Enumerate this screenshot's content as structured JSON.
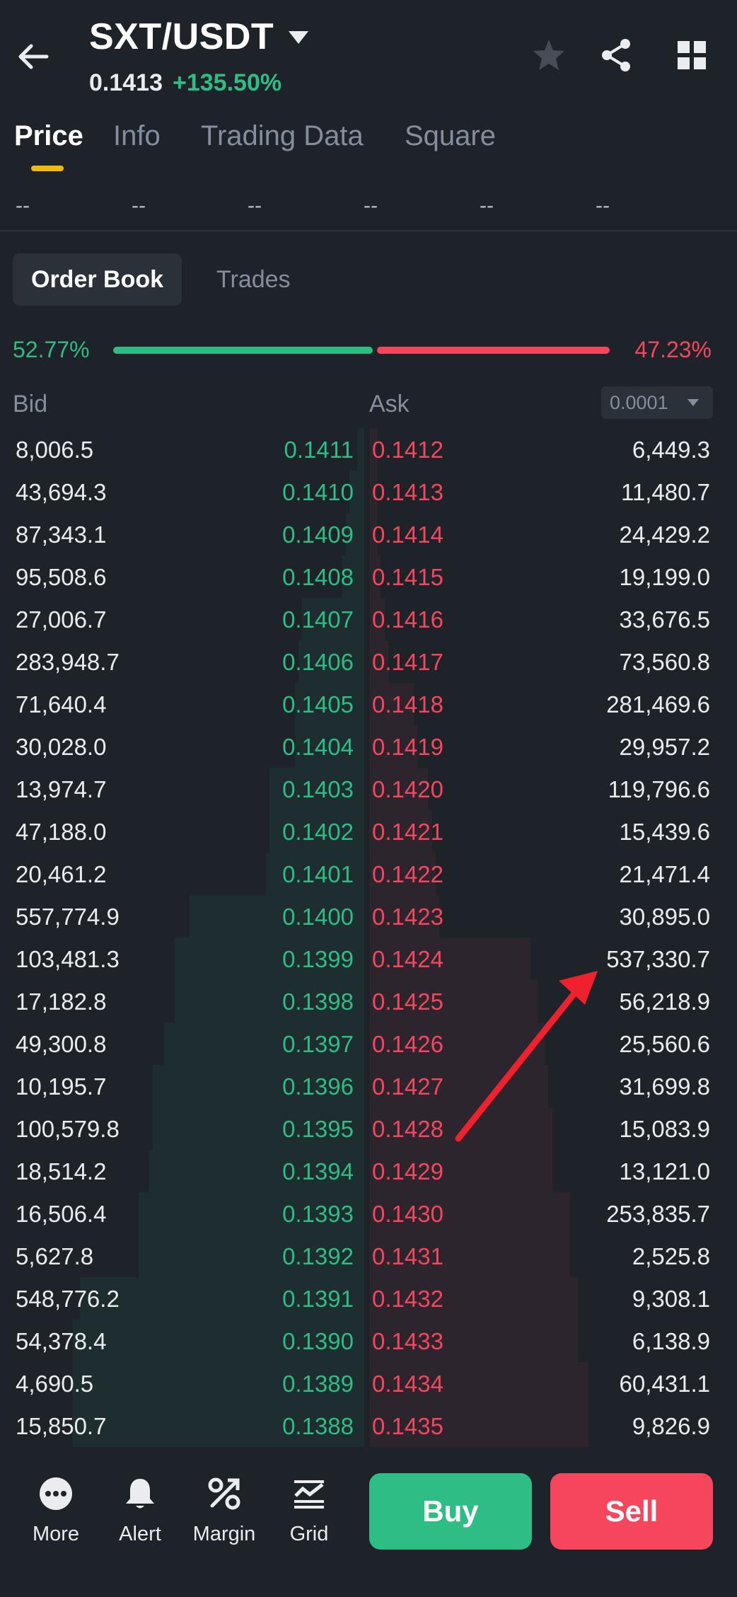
{
  "header": {
    "pair": "SXT/USDT",
    "last_price": "0.1413",
    "change": "+135.50%"
  },
  "tabs": [
    {
      "label": "Price"
    },
    {
      "label": "Info"
    },
    {
      "label": "Trading Data"
    },
    {
      "label": "Square"
    }
  ],
  "periods": [
    {
      "value": "--"
    },
    {
      "value": "--"
    },
    {
      "value": "--"
    },
    {
      "value": "--"
    },
    {
      "value": "--"
    },
    {
      "value": "--"
    }
  ],
  "order_book": {
    "tabs": [
      "Order Book",
      "Trades"
    ],
    "bid_ratio": "52.77%",
    "ask_ratio": "47.23%",
    "bid_ratio_value": 52.77,
    "bid_header": "Bid",
    "ask_header": "Ask",
    "precision": "0.0001",
    "rows": [
      {
        "bid_qty": "8,006.5",
        "bid_price": "0.1411",
        "ask_price": "0.1412",
        "ask_qty": "6,449.3"
      },
      {
        "bid_qty": "43,694.3",
        "bid_price": "0.1410",
        "ask_price": "0.1413",
        "ask_qty": "11,480.7"
      },
      {
        "bid_qty": "87,343.1",
        "bid_price": "0.1409",
        "ask_price": "0.1414",
        "ask_qty": "24,429.2"
      },
      {
        "bid_qty": "95,508.6",
        "bid_price": "0.1408",
        "ask_price": "0.1415",
        "ask_qty": "19,199.0"
      },
      {
        "bid_qty": "27,006.7",
        "bid_price": "0.1407",
        "ask_price": "0.1416",
        "ask_qty": "33,676.5"
      },
      {
        "bid_qty": "283,948.7",
        "bid_price": "0.1406",
        "ask_price": "0.1417",
        "ask_qty": "73,560.8"
      },
      {
        "bid_qty": "71,640.4",
        "bid_price": "0.1405",
        "ask_price": "0.1418",
        "ask_qty": "281,469.6"
      },
      {
        "bid_qty": "30,028.0",
        "bid_price": "0.1404",
        "ask_price": "0.1419",
        "ask_qty": "29,957.2"
      },
      {
        "bid_qty": "13,974.7",
        "bid_price": "0.1403",
        "ask_price": "0.1420",
        "ask_qty": "119,796.6"
      },
      {
        "bid_qty": "47,188.0",
        "bid_price": "0.1402",
        "ask_price": "0.1421",
        "ask_qty": "15,439.6"
      },
      {
        "bid_qty": "20,461.2",
        "bid_price": "0.1401",
        "ask_price": "0.1422",
        "ask_qty": "21,471.4"
      },
      {
        "bid_qty": "557,774.9",
        "bid_price": "0.1400",
        "ask_price": "0.1423",
        "ask_qty": "30,895.0"
      },
      {
        "bid_qty": "103,481.3",
        "bid_price": "0.1399",
        "ask_price": "0.1424",
        "ask_qty": "537,330.7"
      },
      {
        "bid_qty": "17,182.8",
        "bid_price": "0.1398",
        "ask_price": "0.1425",
        "ask_qty": "56,218.9"
      },
      {
        "bid_qty": "49,300.8",
        "bid_price": "0.1397",
        "ask_price": "0.1426",
        "ask_qty": "25,560.6"
      },
      {
        "bid_qty": "10,195.7",
        "bid_price": "0.1396",
        "ask_price": "0.1427",
        "ask_qty": "31,699.8"
      },
      {
        "bid_qty": "100,579.8",
        "bid_price": "0.1395",
        "ask_price": "0.1428",
        "ask_qty": "15,083.9"
      },
      {
        "bid_qty": "18,514.2",
        "bid_price": "0.1394",
        "ask_price": "0.1429",
        "ask_qty": "13,121.0"
      },
      {
        "bid_qty": "16,506.4",
        "bid_price": "0.1393",
        "ask_price": "0.1430",
        "ask_qty": "253,835.7"
      },
      {
        "bid_qty": "5,627.8",
        "bid_price": "0.1392",
        "ask_price": "0.1431",
        "ask_qty": "2,525.8"
      },
      {
        "bid_qty": "548,776.2",
        "bid_price": "0.1391",
        "ask_price": "0.1432",
        "ask_qty": "9,308.1"
      },
      {
        "bid_qty": "54,378.4",
        "bid_price": "0.1390",
        "ask_price": "0.1433",
        "ask_qty": "6,138.9"
      },
      {
        "bid_qty": "4,690.5",
        "bid_price": "0.1389",
        "ask_price": "0.1434",
        "ask_qty": "60,431.1"
      },
      {
        "bid_qty": "15,850.7",
        "bid_price": "0.1388",
        "ask_price": "0.1435",
        "ask_qty": "9,826.9"
      }
    ],
    "bid_depth_fraction": [
      0.02,
      0.04,
      0.05,
      0.06,
      0.17,
      0.18,
      0.19,
      0.19,
      0.26,
      0.26,
      0.27,
      0.48,
      0.52,
      0.52,
      0.55,
      0.58,
      0.58,
      0.59,
      0.62,
      0.62,
      0.78,
      0.8,
      0.8,
      0.8
    ],
    "ask_depth_fraction": [
      0.02,
      0.02,
      0.02,
      0.03,
      0.04,
      0.05,
      0.12,
      0.13,
      0.16,
      0.17,
      0.18,
      0.19,
      0.44,
      0.46,
      0.48,
      0.49,
      0.5,
      0.5,
      0.55,
      0.55,
      0.57,
      0.57,
      0.6,
      0.6
    ]
  },
  "annotation": {
    "color": "#f0202d"
  },
  "bottom_bar": {
    "nav": [
      {
        "label": "More",
        "icon": "more-icon"
      },
      {
        "label": "Alert",
        "icon": "bell-icon"
      },
      {
        "label": "Margin",
        "icon": "percent-icon"
      },
      {
        "label": "Grid",
        "icon": "grid-chart-icon"
      }
    ],
    "buy_label": "Buy",
    "sell_label": "Sell"
  },
  "colors": {
    "background": "#1e2329",
    "bid_green": "#2ebd85",
    "ask_red": "#f6465d",
    "accent_yellow": "#f0b90b",
    "muted_text": "#848e9c"
  }
}
